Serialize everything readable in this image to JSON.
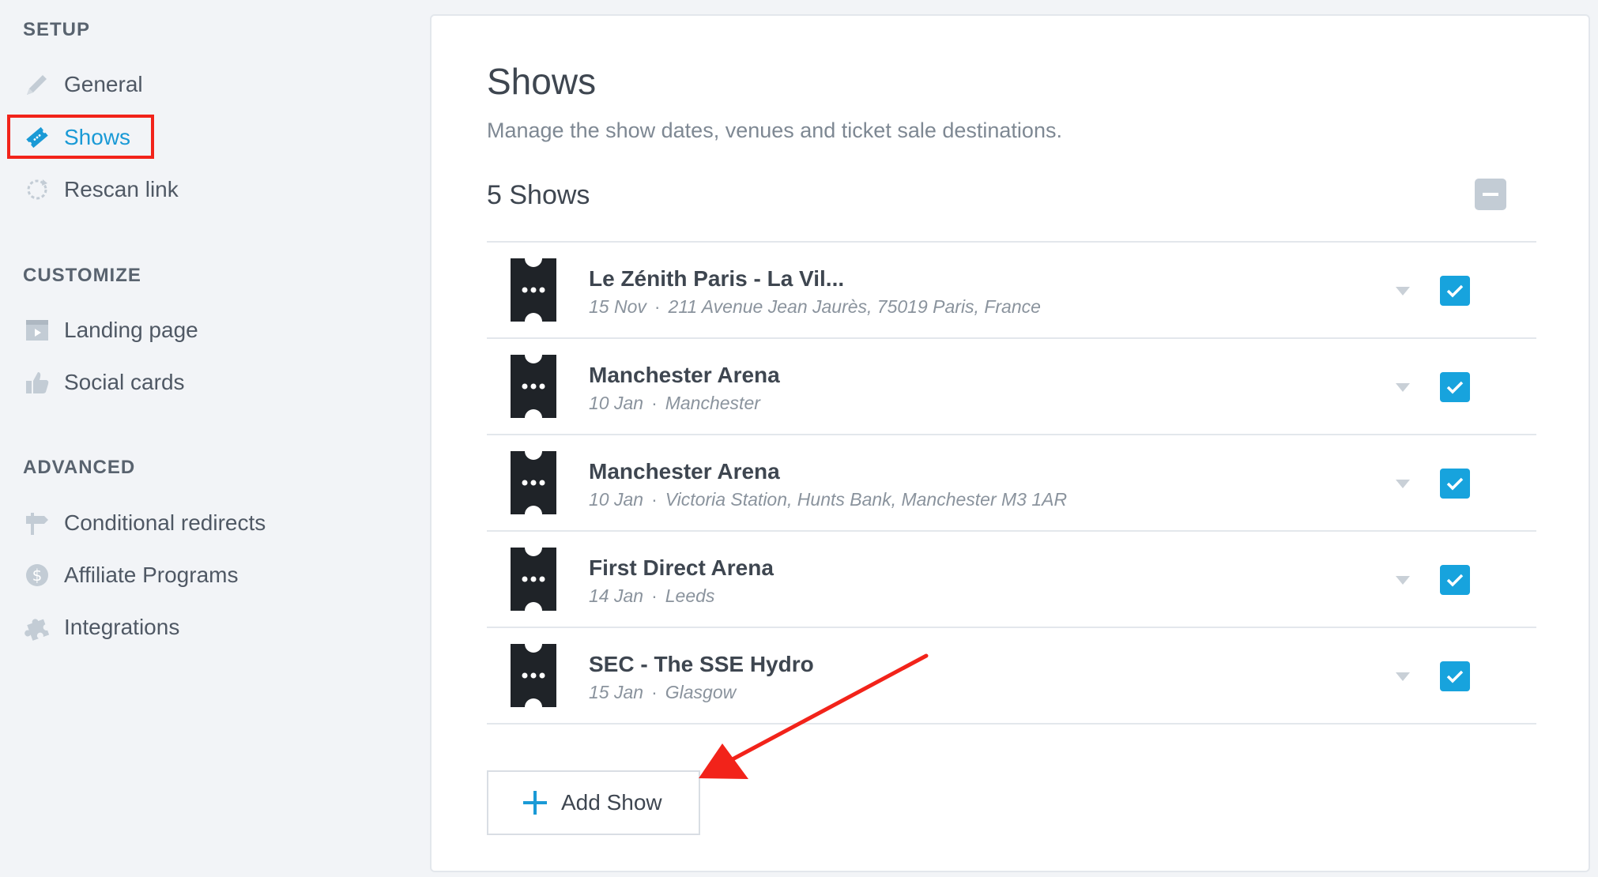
{
  "sidebar": {
    "setup_title": "SETUP",
    "customize_title": "CUSTOMIZE",
    "advanced_title": "ADVANCED",
    "items": [
      {
        "label": "General",
        "icon": "pencil-icon"
      },
      {
        "label": "Shows",
        "icon": "ticket-icon",
        "active": true
      },
      {
        "label": "Rescan link",
        "icon": "refresh-icon"
      },
      {
        "label": "Landing page",
        "icon": "landing-page-icon"
      },
      {
        "label": "Social cards",
        "icon": "thumbs-up-icon"
      },
      {
        "label": "Conditional redirects",
        "icon": "signpost-icon"
      },
      {
        "label": "Affiliate Programs",
        "icon": "dollar-icon"
      },
      {
        "label": "Integrations",
        "icon": "puzzle-icon"
      }
    ]
  },
  "main": {
    "title": "Shows",
    "subtitle": "Manage the show dates, venues and ticket sale destinations.",
    "count_label": "5 Shows",
    "shows": [
      {
        "name": "Le Zénith Paris - La Vil...",
        "date": "15 Nov",
        "location": "211 Avenue Jean Jaurès, 75019 Paris, France",
        "checked": true
      },
      {
        "name": "Manchester Arena",
        "date": "10 Jan",
        "location": "Manchester",
        "checked": true
      },
      {
        "name": "Manchester Arena",
        "date": "10 Jan",
        "location": "Victoria Station, Hunts Bank, Manchester M3 1AR",
        "checked": true
      },
      {
        "name": "First Direct Arena",
        "date": "14 Jan",
        "location": "Leeds",
        "checked": true
      },
      {
        "name": "SEC - The SSE Hydro",
        "date": "15 Jan",
        "location": "Glasgow",
        "checked": true
      }
    ],
    "meta_separator": "·",
    "add_button_label": "Add Show"
  },
  "colors": {
    "accent": "#1a9ad6",
    "highlight": "#f2231a",
    "checkbox": "#17a3dd"
  }
}
